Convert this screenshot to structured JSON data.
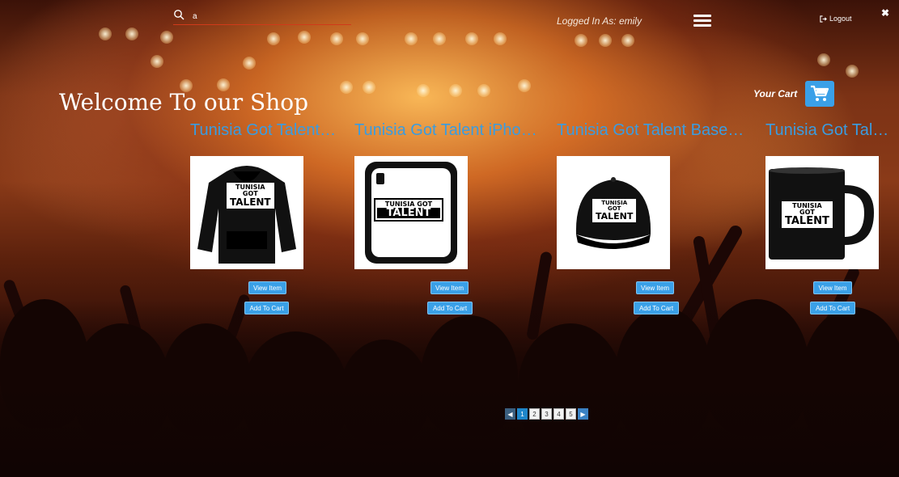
{
  "header": {
    "search_value": "a",
    "logged_in_text": "Logged In As: emily",
    "logout_label": "Logout",
    "close_glyph": "✖"
  },
  "welcome_title": "Welcome To our Shop",
  "cart": {
    "label": "Your Cart"
  },
  "products": [
    {
      "title": "Tunisia Got Talent Hoodie",
      "view_label": "View Item",
      "add_label": "Add To Cart"
    },
    {
      "title": "Tunisia Got Talent iPhone Case",
      "view_label": "View Item",
      "add_label": "Add To Cart"
    },
    {
      "title": "Tunisia Got Talent Base Cap",
      "view_label": "View Item",
      "add_label": "Add To Cart"
    },
    {
      "title": "Tunisia Got Talent Mug",
      "view_label": "View Item",
      "add_label": "Add To Cart"
    }
  ],
  "logo_text": {
    "line1": "TUNISIA GOT",
    "line2": "TALENT"
  },
  "pagination": {
    "prev": "◀",
    "next": "▶",
    "pages": [
      "1",
      "2",
      "3",
      "4",
      "5"
    ],
    "current": "1"
  },
  "colors": {
    "accent": "#3aa0e8",
    "title_blue": "#3a9ce0",
    "search_underline": "#d03a1a"
  }
}
